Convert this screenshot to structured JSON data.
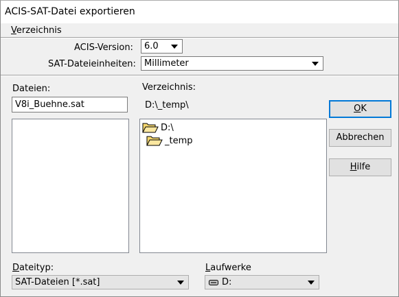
{
  "window": {
    "title": "ACIS-SAT-Datei exportieren"
  },
  "menu": {
    "items": [
      {
        "label": "Verzeichnis",
        "mnemonic_index": 0
      }
    ]
  },
  "options": {
    "acis_version_label": "ACIS-Version:",
    "acis_version_value": "6.0",
    "units_label": "SAT-Dateieinheiten:",
    "units_value": "Millimeter"
  },
  "files": {
    "label": "Dateien:",
    "filename_value": "V8i_Buehne.sat",
    "list": []
  },
  "directory": {
    "label": "Verzeichnis:",
    "current_path": "D:\\_temp\\",
    "tree": [
      {
        "name": "D:\\",
        "icon": "open-folder-icon"
      },
      {
        "name": "_temp",
        "icon": "open-folder-icon"
      }
    ]
  },
  "buttons": {
    "ok": "OK",
    "cancel": "Abbrechen",
    "help": "Hilfe"
  },
  "filetype": {
    "label": "Dateityp:",
    "value": "SAT-Dateien [*.sat]"
  },
  "drives": {
    "label": "Laufwerke",
    "value": "D:",
    "icon": "drive-icon"
  },
  "colors": {
    "default_button_border": "#0078d7",
    "background": "#f0f0f0",
    "folder_fill": "#f5d76e",
    "folder_stroke": "#000000"
  }
}
